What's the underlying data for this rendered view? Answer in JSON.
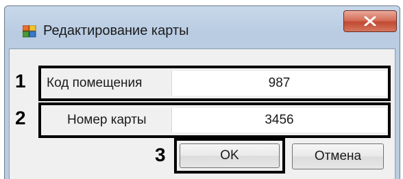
{
  "window": {
    "title": "Редактирование карты",
    "close_label": "X"
  },
  "annotations": [
    "1",
    "2",
    "3"
  ],
  "fields": [
    {
      "label": "Код помещения",
      "value": "987"
    },
    {
      "label": "Номер карты",
      "value": "3456"
    }
  ],
  "buttons": {
    "ok_label": "OK",
    "cancel_label": "Отмена"
  },
  "colors": {
    "title_bar": "#b9cce2",
    "client_area": "#f0f0f0",
    "close_button": "#c24a33",
    "annotation_border": "#000000"
  },
  "icons": {
    "app": "form-window-icon",
    "close": "close-icon"
  }
}
